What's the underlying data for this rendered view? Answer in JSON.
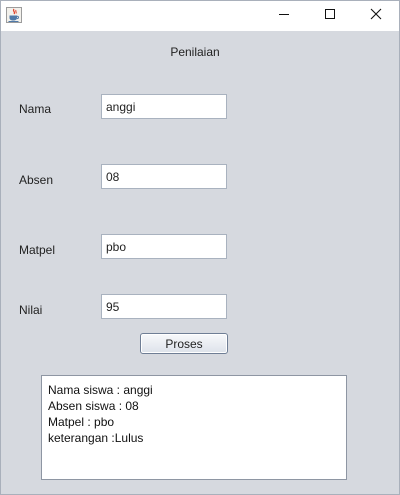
{
  "window": {
    "title": "",
    "app_icon": "java-cup-icon",
    "controls": {
      "minimize_icon": "minimize-icon",
      "maximize_icon": "maximize-icon",
      "close_icon": "close-icon"
    }
  },
  "form": {
    "heading": "Penilaian",
    "fields": [
      {
        "label": "Nama",
        "value": "anggi"
      },
      {
        "label": "Absen",
        "value": "08"
      },
      {
        "label": "Matpel",
        "value": "pbo"
      },
      {
        "label": "Nilai",
        "value": "95"
      }
    ],
    "submit_label": "Proses"
  },
  "output": {
    "lines": [
      "Nama siswa : anggi",
      "Absen siswa : 08",
      "Matpel : pbo",
      "keterangan :Lulus"
    ]
  }
}
